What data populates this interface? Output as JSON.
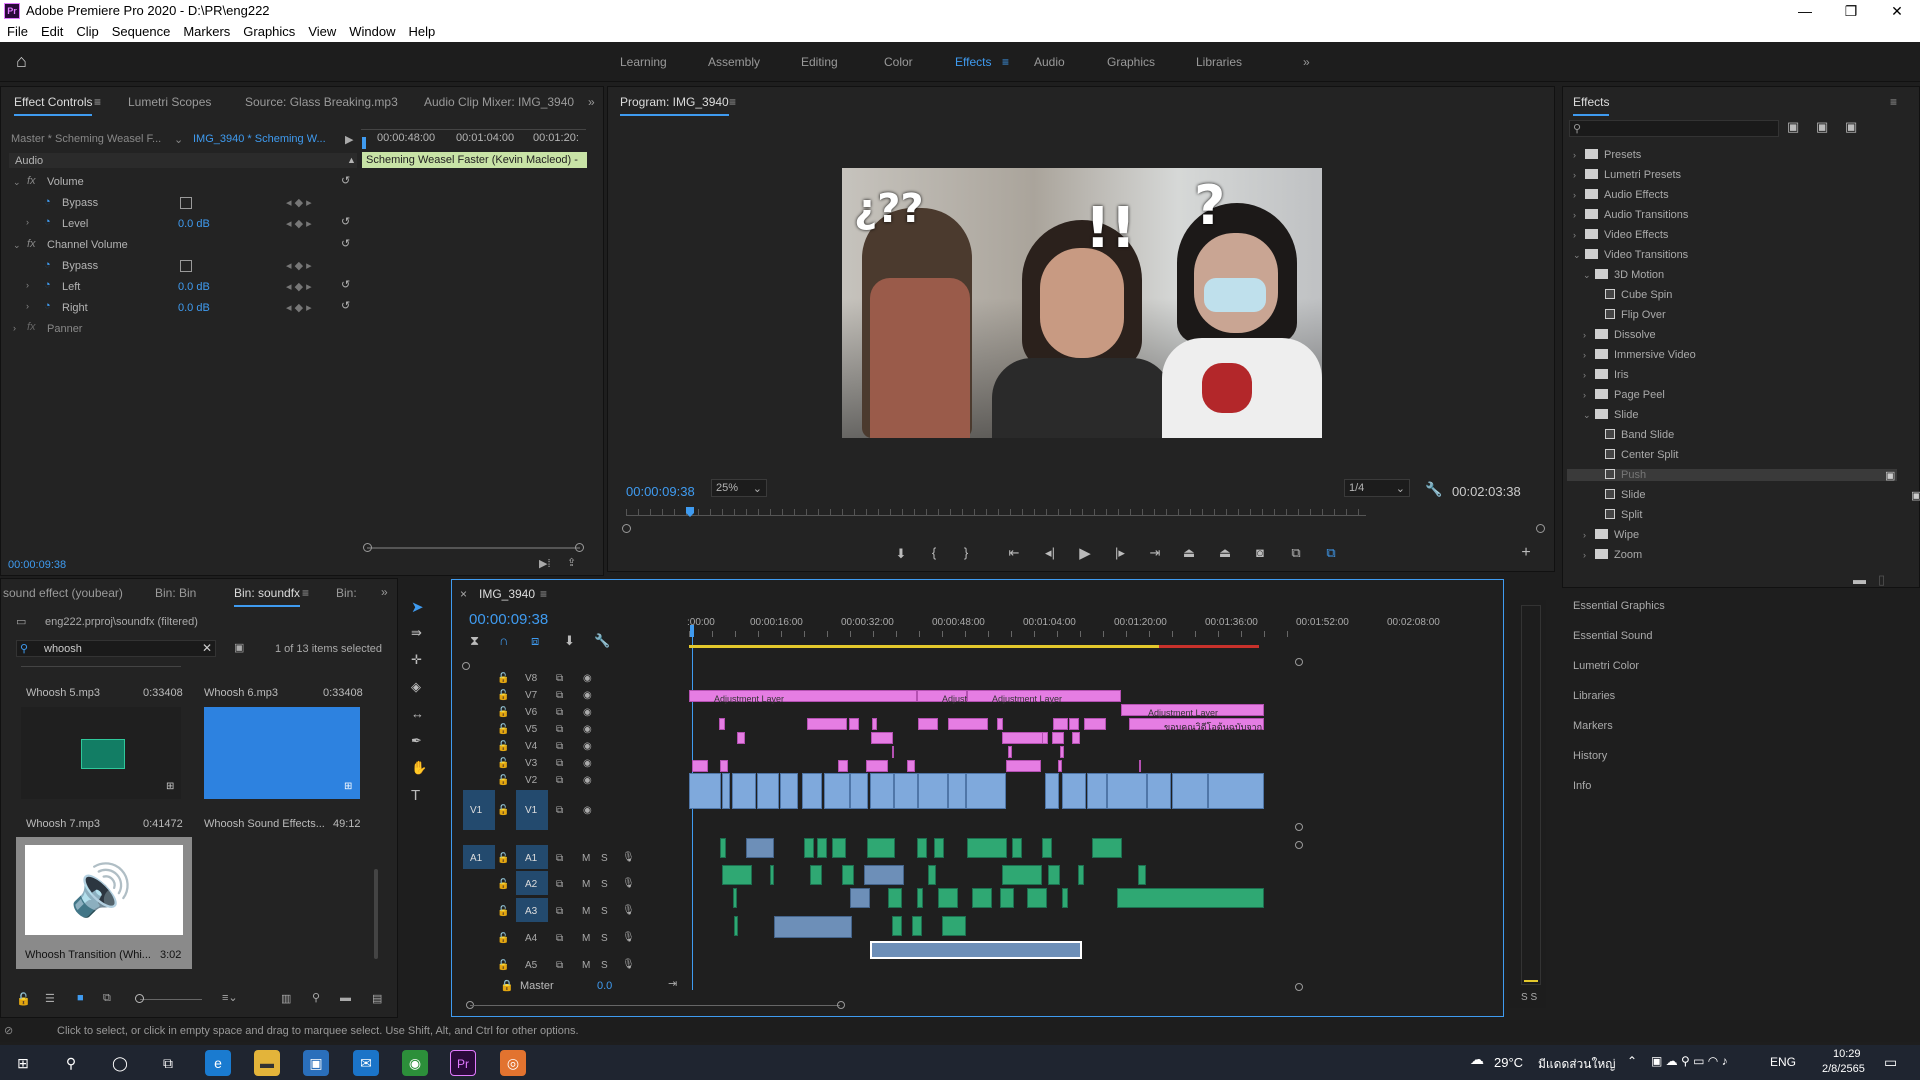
{
  "window": {
    "title": "Adobe Premiere Pro 2020 - D:\\PR\\eng222",
    "app_icon": "Pr",
    "min": "—",
    "max": "❐",
    "close": "✕"
  },
  "menu": [
    "File",
    "Edit",
    "Clip",
    "Sequence",
    "Markers",
    "Graphics",
    "View",
    "Window",
    "Help"
  ],
  "workspaces": [
    {
      "label": "Learning"
    },
    {
      "label": "Assembly"
    },
    {
      "label": "Editing"
    },
    {
      "label": "Color"
    },
    {
      "label": "Effects",
      "active": true
    },
    {
      "label": "Audio"
    },
    {
      "label": "Graphics"
    },
    {
      "label": "Libraries"
    }
  ],
  "effect_controls": {
    "tabs": [
      "Effect Controls",
      "Lumetri Scopes",
      "Source: Glass Breaking.mp3",
      "Audio Clip Mixer: IMG_3940"
    ],
    "master": "Master * Scheming Weasel F...",
    "clip": "IMG_3940 * Scheming W...",
    "times": [
      "00:00:48:00",
      "00:01:04:00",
      "00:01:20:"
    ],
    "clip_bar": "Scheming Weasel Faster (Kevin Macleod) -",
    "section": "Audio",
    "rows": [
      {
        "label": "Volume",
        "kind": "fx"
      },
      {
        "label": "Bypass",
        "kind": "check"
      },
      {
        "label": "Level",
        "value": "0.0 dB"
      },
      {
        "label": "Channel Volume",
        "kind": "fx"
      },
      {
        "label": "Bypass",
        "kind": "check"
      },
      {
        "label": "Left",
        "value": "0.0 dB"
      },
      {
        "label": "Right",
        "value": "0.0 dB"
      },
      {
        "label": "Panner",
        "kind": "fx-dim"
      }
    ],
    "timecode": "00:00:09:38"
  },
  "program": {
    "title": "Program: IMG_3940",
    "timecode": "00:00:09:38",
    "zoom": "25%",
    "quality": "1/4",
    "duration": "00:02:03:38",
    "overlay_left": "¿??",
    "overlay_mid": "!!",
    "overlay_right": "?"
  },
  "effects": {
    "title": "Effects",
    "tree": [
      {
        "label": "Presets",
        "level": 0,
        "type": "folder"
      },
      {
        "label": "Lumetri Presets",
        "level": 0,
        "type": "folder"
      },
      {
        "label": "Audio Effects",
        "level": 0,
        "type": "folder"
      },
      {
        "label": "Audio Transitions",
        "level": 0,
        "type": "folder"
      },
      {
        "label": "Video Effects",
        "level": 0,
        "type": "folder"
      },
      {
        "label": "Video Transitions",
        "level": 0,
        "type": "folder",
        "open": true
      },
      {
        "label": "3D Motion",
        "level": 1,
        "type": "folder",
        "open": true
      },
      {
        "label": "Cube Spin",
        "level": 2,
        "type": "fx"
      },
      {
        "label": "Flip Over",
        "level": 2,
        "type": "fx"
      },
      {
        "label": "Dissolve",
        "level": 1,
        "type": "folder"
      },
      {
        "label": "Immersive Video",
        "level": 1,
        "type": "folder"
      },
      {
        "label": "Iris",
        "level": 1,
        "type": "folder"
      },
      {
        "label": "Page Peel",
        "level": 1,
        "type": "folder"
      },
      {
        "label": "Slide",
        "level": 1,
        "type": "folder",
        "open": true
      },
      {
        "label": "Band Slide",
        "level": 2,
        "type": "fx"
      },
      {
        "label": "Center Split",
        "level": 2,
        "type": "fx"
      },
      {
        "label": "Push",
        "level": 2,
        "type": "fx",
        "selected": true
      },
      {
        "label": "Slide",
        "level": 2,
        "type": "fx"
      },
      {
        "label": "Split",
        "level": 2,
        "type": "fx"
      },
      {
        "label": "Wipe",
        "level": 1,
        "type": "folder"
      },
      {
        "label": "Zoom",
        "level": 1,
        "type": "folder"
      }
    ],
    "side_panels": [
      "Essential Graphics",
      "Essential Sound",
      "Lumetri Color",
      "Libraries",
      "Markers",
      "History",
      "Info"
    ]
  },
  "project": {
    "tabs": [
      "sound effect (youbear)",
      "Bin: Bin",
      "Bin: soundfx",
      "Bin:"
    ],
    "path": "eng222.prproj\\soundfx (filtered)",
    "search": "whoosh",
    "selected": "1 of 13 items selected",
    "items": [
      {
        "name": "Whoosh 5.mp3",
        "dur": "0:33408"
      },
      {
        "name": "Whoosh 6.mp3",
        "dur": "0:33408"
      },
      {
        "name": "Whoosh 7.mp3",
        "dur": "0:41472"
      },
      {
        "name": "Whoosh Sound Effects...",
        "dur": "49:12"
      },
      {
        "name": "Whoosh Transition (Whi...",
        "dur": "3:02"
      }
    ]
  },
  "timeline": {
    "tab": "IMG_3940",
    "timecode": "00:00:09:38",
    "ruler": [
      ":00:00",
      "00:00:16:00",
      "00:00:32:00",
      "00:00:48:00",
      "00:01:04:00",
      "00:01:20:00",
      "00:01:36:00",
      "00:01:52:00",
      "00:02:08:00"
    ],
    "video_tracks": [
      "V8",
      "V7",
      "V6",
      "V5",
      "V4",
      "V3",
      "V2",
      "V1"
    ],
    "audio_tracks": [
      "A1",
      "A2",
      "A3",
      "A4",
      "A5"
    ],
    "master_label": "Master",
    "master_value": "0.0",
    "adj1": "Adjustment Layer",
    "adj2": "Adjust",
    "adj3": "Adjustment Layer",
    "adj4": "Adjustment Layer",
    "thai_title": "ขอบคุณวิดีโอต้นฉบับจาก",
    "solo": "S S"
  },
  "status": "Click to select, or click in empty space and drag to marquee select. Use Shift, Alt, and Ctrl for other options.",
  "taskbar": {
    "temp": "29°C",
    "weather": "มีแดดส่วนใหญ่",
    "lang": "ENG",
    "time": "10:29",
    "date": "2/8/2565"
  },
  "colors": {
    "accent": "#3f9bf0",
    "pink_clip": "#e57de3",
    "video_clip": "#7fa9dc",
    "audio_green": "#2fa873"
  }
}
